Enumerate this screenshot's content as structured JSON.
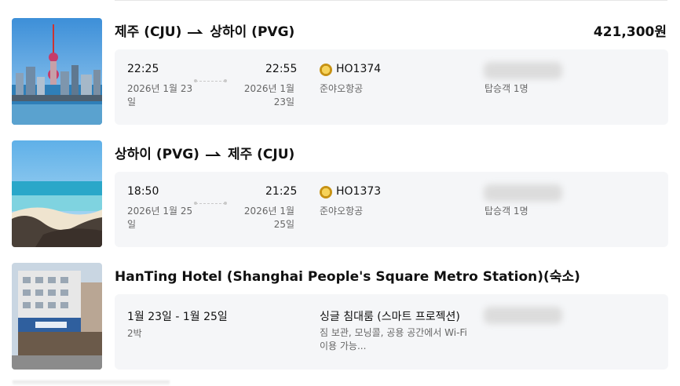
{
  "trips": [
    {
      "route_from": "제주 (CJU)",
      "route_to": "상하이 (PVG)",
      "price": "421,300원",
      "depart_time": "22:25",
      "arrive_time": "22:55",
      "depart_date": "2026년 1월 23일",
      "arrive_date": "2026년 1월 23일",
      "flight_no": "HO1374",
      "airline": "준야오항공",
      "passengers": "탑승객 1명",
      "image": "shanghai-skyline"
    },
    {
      "route_from": "상하이 (PVG)",
      "route_to": "제주 (CJU)",
      "depart_time": "18:50",
      "arrive_time": "21:25",
      "depart_date": "2026년 1월 25일",
      "arrive_date": "2026년 1월 25일",
      "flight_no": "HO1373",
      "airline": "준야오항공",
      "passengers": "탑승객 1명",
      "image": "jeju-coast"
    }
  ],
  "hotel": {
    "name": "HanTing Hotel (Shanghai People's Square Metro Station)(숙소)",
    "dates": "1월 23일 - 1월 25일",
    "nights": "2박",
    "room": "싱글 침대룸 (스마트 프로젝션)",
    "description": "짐 보관, 모닝콜, 공용 공간에서 Wi-Fi 이용 가능...",
    "image": "hotel-building"
  },
  "arrow_icon": "arrow-right-icon",
  "airline_logo_icon": "airline-logo-icon"
}
